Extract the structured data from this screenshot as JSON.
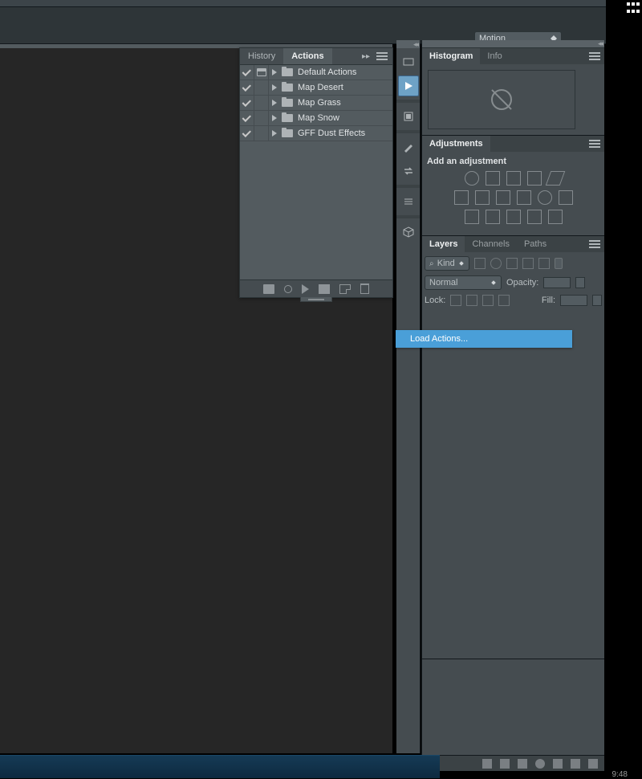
{
  "topbar": {
    "workspace": "Motion"
  },
  "actions_panel": {
    "tabs": {
      "history": "History",
      "actions": "Actions"
    },
    "items": [
      {
        "checked": true,
        "modal": true,
        "label": "Default Actions"
      },
      {
        "checked": true,
        "modal": false,
        "label": "Map Desert"
      },
      {
        "checked": true,
        "modal": false,
        "label": "Map Grass"
      },
      {
        "checked": true,
        "modal": false,
        "label": "Map Snow"
      },
      {
        "checked": true,
        "modal": false,
        "label": "GFF Dust Effects"
      }
    ]
  },
  "context_menu": {
    "load_actions": "Load Actions..."
  },
  "histogram_panel": {
    "tabs": {
      "histogram": "Histogram",
      "info": "Info"
    }
  },
  "adjustments_panel": {
    "tab": "Adjustments",
    "heading": "Add an adjustment"
  },
  "layers_panel": {
    "tabs": {
      "layers": "Layers",
      "channels": "Channels",
      "paths": "Paths"
    },
    "kind_label": "Kind",
    "blend_mode": "Normal",
    "opacity_label": "Opacity:",
    "lock_label": "Lock:",
    "fill_label": "Fill:"
  },
  "taskbar": {
    "clock": "9:48"
  }
}
